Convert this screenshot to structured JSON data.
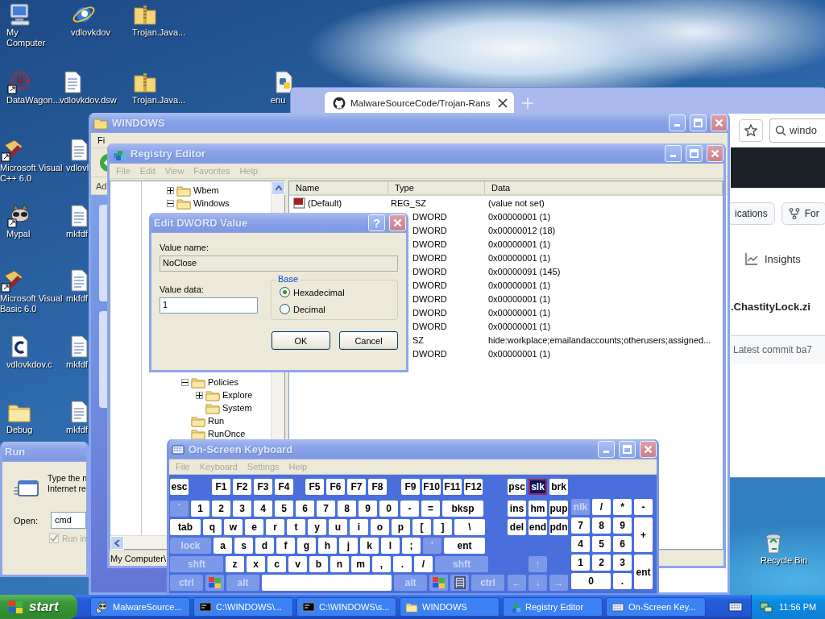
{
  "desktop_icons": [
    {
      "label": "My Computer",
      "kind": "computer"
    },
    {
      "label": "vdlovkdov",
      "kind": "globe"
    },
    {
      "label": "Trojan.Java...",
      "kind": "zip"
    },
    {
      "label": "DataWagon...",
      "kind": "wheel"
    },
    {
      "label": "vdlovkdov.dsw",
      "kind": "doc"
    },
    {
      "label": "Trojan.Java...",
      "kind": "zip"
    },
    {
      "label": "enu",
      "kind": "script"
    },
    {
      "label": "Microsoft Visual C++ 6.0",
      "kind": "tools"
    },
    {
      "label": "vdlovl",
      "kind": "doc"
    },
    {
      "label": "Mypal",
      "kind": "animal"
    },
    {
      "label": "mkfdf",
      "kind": "doc"
    },
    {
      "label": "Microsoft Visual Basic 6.0",
      "kind": "tools"
    },
    {
      "label": "mkfdf",
      "kind": "doc"
    },
    {
      "label": "vdlovkdov.c",
      "kind": "cfile"
    },
    {
      "label": "mkfdf",
      "kind": "doc"
    },
    {
      "label": "Debug",
      "kind": "folder"
    },
    {
      "label": "mkfdf",
      "kind": "doc"
    },
    {
      "label": "Recycle Bin",
      "kind": "bin"
    }
  ],
  "browser": {
    "tab_title": "MalwareSourceCode/Trojan-Rans",
    "search_value": "windo",
    "buttons": [
      {
        "label": "ications",
        "kind": "plain"
      },
      {
        "label": "For",
        "kind": "fork"
      }
    ],
    "insights": "Insights",
    "file_title": ".ChastityLock.zi",
    "commit": "Latest commit ba7"
  },
  "explorer": {
    "title": "WINDOWS",
    "menu_first": "Fi",
    "address_label": "Ad"
  },
  "run": {
    "title": "Run",
    "description": [
      "Type the n",
      "Internet re"
    ],
    "open_label": "Open:",
    "command": "cmd",
    "checkbox": {
      "label": "Run in",
      "checked": true,
      "disabled": true
    }
  },
  "regedit": {
    "title": "Registry Editor",
    "menu": [
      {
        "label": "File",
        "disabled": true
      },
      {
        "label": "Edit",
        "disabled": true
      },
      {
        "label": "View",
        "disabled": true
      },
      {
        "label": "Favorites",
        "disabled": true
      },
      {
        "label": "Help",
        "disabled": true
      }
    ],
    "tree": [
      {
        "label": "Wbem",
        "expanded": false
      },
      {
        "label": "Windows",
        "expanded": true,
        "children": [
          {
            "label": "Policies",
            "expanded": true,
            "children": [
              {
                "label": "Explore",
                "expanded": false
              },
              {
                "label": "System"
              }
            ]
          },
          {
            "label": "Run"
          },
          {
            "label": "RunOnce"
          }
        ]
      }
    ],
    "columns": [
      "Name",
      "Type",
      "Data"
    ],
    "rows": [
      {
        "name": "(Default)",
        "type": "REG_SZ",
        "data": "(value not set)"
      },
      {
        "type": "DWORD",
        "data": "0x00000001 (1)"
      },
      {
        "type": "DWORD",
        "data": "0x00000012 (18)"
      },
      {
        "type": "DWORD",
        "data": "0x00000001 (1)"
      },
      {
        "type": "DWORD",
        "data": "0x00000001 (1)"
      },
      {
        "type": "DWORD",
        "data": "0x00000091 (145)"
      },
      {
        "type": "DWORD",
        "data": "0x00000001 (1)"
      },
      {
        "type": "DWORD",
        "data": "0x00000001 (1)"
      },
      {
        "type": "DWORD",
        "data": "0x00000001 (1)"
      },
      {
        "type": "DWORD",
        "data": "0x00000001 (1)"
      },
      {
        "type": "SZ",
        "data": "hide:workplace;emailandaccounts;otherusers;assigned..."
      },
      {
        "type": "DWORD",
        "data": "0x00000001 (1)"
      }
    ],
    "status": "My Computer\\"
  },
  "dialog": {
    "title": "Edit DWORD Value",
    "help_button": "?",
    "value_name_label": "Value name:",
    "value_name": "NoClose",
    "value_data_label": "Value data:",
    "value_data": "1",
    "base_label": "Base",
    "bases": [
      {
        "label": "Hexadecimal",
        "selected": true
      },
      {
        "label": "Decimal",
        "selected": false
      }
    ],
    "buttons": [
      "OK",
      "Cancel"
    ]
  },
  "osk": {
    "title": "On-Screen Keyboard",
    "menu": [
      {
        "label": "File",
        "disabled": true
      },
      {
        "label": "Keyboard",
        "disabled": true
      },
      {
        "label": "Settings",
        "disabled": true
      },
      {
        "label": "Help",
        "disabled": true
      }
    ],
    "function_row": [
      {
        "label": "esc",
        "muted": false,
        "on": false
      },
      {
        "label": "F1",
        "muted": false,
        "on": false
      },
      {
        "label": "F2",
        "muted": false,
        "on": false
      },
      {
        "label": "F3",
        "muted": false,
        "on": false
      },
      {
        "label": "F4",
        "muted": false,
        "on": false
      },
      {
        "label": "F5",
        "muted": false,
        "on": false
      },
      {
        "label": "F6",
        "muted": false,
        "on": false
      },
      {
        "label": "F7",
        "muted": false,
        "on": false
      },
      {
        "label": "F8",
        "muted": false,
        "on": false
      },
      {
        "label": "F9",
        "muted": false,
        "on": false
      },
      {
        "label": "F10",
        "muted": false,
        "on": false
      },
      {
        "label": "F11",
        "muted": false,
        "on": false
      },
      {
        "label": "F12",
        "muted": false,
        "on": false
      }
    ],
    "main_rows": [
      [
        {
          "label": "`",
          "kind": "char",
          "muted": true,
          "on": false
        },
        {
          "label": "1",
          "kind": "char",
          "muted": false,
          "on": false
        },
        {
          "label": "2",
          "kind": "char",
          "muted": false,
          "on": false
        },
        {
          "label": "3",
          "kind": "char",
          "muted": false,
          "on": false
        },
        {
          "label": "4",
          "kind": "char",
          "muted": false,
          "on": false
        },
        {
          "label": "5",
          "kind": "char",
          "muted": false,
          "on": false
        },
        {
          "label": "6",
          "kind": "char",
          "muted": false,
          "on": false
        },
        {
          "label": "7",
          "kind": "char",
          "muted": false,
          "on": false
        },
        {
          "label": "8",
          "kind": "char",
          "muted": false,
          "on": false
        },
        {
          "label": "9",
          "kind": "char",
          "muted": false,
          "on": false
        },
        {
          "label": "0",
          "kind": "char",
          "muted": false,
          "on": false
        },
        {
          "label": "-",
          "kind": "char",
          "muted": false,
          "on": false
        },
        {
          "label": "=",
          "kind": "char",
          "muted": false,
          "on": false
        },
        {
          "label": "bksp",
          "kind": "double",
          "muted": false,
          "on": false
        }
      ],
      [
        {
          "label": "tab",
          "kind": "wide",
          "muted": false,
          "on": false
        },
        {
          "label": "q",
          "kind": "char",
          "muted": false,
          "on": false
        },
        {
          "label": "w",
          "kind": "char",
          "muted": false,
          "on": false
        },
        {
          "label": "e",
          "kind": "char",
          "muted": false,
          "on": false
        },
        {
          "label": "r",
          "kind": "char",
          "muted": false,
          "on": false
        },
        {
          "label": "t",
          "kind": "char",
          "muted": false,
          "on": false
        },
        {
          "label": "y",
          "kind": "char",
          "muted": false,
          "on": false
        },
        {
          "label": "u",
          "kind": "char",
          "muted": false,
          "on": false
        },
        {
          "label": "i",
          "kind": "char",
          "muted": false,
          "on": false
        },
        {
          "label": "o",
          "kind": "char",
          "muted": false,
          "on": false
        },
        {
          "label": "p",
          "kind": "char",
          "muted": false,
          "on": false
        },
        {
          "label": "[",
          "kind": "char",
          "muted": false,
          "on": false
        },
        {
          "label": "]",
          "kind": "char",
          "muted": false,
          "on": false
        },
        {
          "label": "\\",
          "kind": "wide",
          "muted": false,
          "on": false
        }
      ],
      [
        {
          "label": "lock",
          "kind": "double",
          "muted": true,
          "on": false
        },
        {
          "label": "a",
          "kind": "char",
          "muted": false,
          "on": false
        },
        {
          "label": "s",
          "kind": "char",
          "muted": false,
          "on": false
        },
        {
          "label": "d",
          "kind": "char",
          "muted": false,
          "on": false
        },
        {
          "label": "f",
          "kind": "char",
          "muted": false,
          "on": false
        },
        {
          "label": "g",
          "kind": "char",
          "muted": false,
          "on": false
        },
        {
          "label": "h",
          "kind": "char",
          "muted": false,
          "on": false
        },
        {
          "label": "j",
          "kind": "char",
          "muted": false,
          "on": false
        },
        {
          "label": "k",
          "kind": "char",
          "muted": false,
          "on": false
        },
        {
          "label": "l",
          "kind": "char",
          "muted": false,
          "on": false
        },
        {
          "label": ";",
          "kind": "char",
          "muted": false,
          "on": false
        },
        {
          "label": "'",
          "kind": "char",
          "muted": true,
          "on": false
        },
        {
          "label": "ent",
          "kind": "double",
          "muted": false,
          "on": false
        }
      ],
      [
        {
          "label": "shft",
          "kind": "shift",
          "muted": true,
          "on": false
        },
        {
          "label": "z",
          "kind": "char",
          "muted": false,
          "on": false
        },
        {
          "label": "x",
          "kind": "char",
          "muted": false,
          "on": false
        },
        {
          "label": "c",
          "kind": "char",
          "muted": false,
          "on": false
        },
        {
          "label": "v",
          "kind": "char",
          "muted": false,
          "on": false
        },
        {
          "label": "b",
          "kind": "char",
          "muted": false,
          "on": false
        },
        {
          "label": "n",
          "kind": "char",
          "muted": false,
          "on": false
        },
        {
          "label": "m",
          "kind": "char",
          "muted": false,
          "on": false
        },
        {
          "label": ",",
          "kind": "char",
          "muted": false,
          "on": false
        },
        {
          "label": ".",
          "kind": "char",
          "muted": false,
          "on": false
        },
        {
          "label": "/",
          "kind": "char",
          "muted": false,
          "on": false
        },
        {
          "label": "shft",
          "kind": "shift",
          "muted": true,
          "on": false
        }
      ],
      [
        {
          "label": "ctrl",
          "kind": "mod",
          "muted": true,
          "on": false
        },
        {
          "kind": "win",
          "muted": true,
          "on": false
        },
        {
          "label": "alt",
          "kind": "mod",
          "muted": true,
          "on": false
        },
        {
          "kind": "space",
          "muted": false,
          "on": false
        },
        {
          "label": "alt",
          "kind": "mod",
          "muted": true,
          "on": false
        },
        {
          "kind": "win",
          "muted": true,
          "on": false
        },
        {
          "kind": "menu",
          "muted": true,
          "on": false
        },
        {
          "label": "ctrl",
          "kind": "mod",
          "muted": true,
          "on": false
        }
      ]
    ],
    "nav_rows": [
      [
        {
          "label": "psc",
          "muted": false,
          "on": false
        },
        {
          "label": "slk",
          "muted": false,
          "on": true
        },
        {
          "label": "brk",
          "muted": false,
          "on": false
        }
      ],
      [
        {
          "label": "ins",
          "muted": false,
          "on": false
        },
        {
          "label": "hm",
          "muted": false,
          "on": false
        },
        {
          "label": "pup",
          "muted": false,
          "on": false
        }
      ],
      [
        {
          "label": "del",
          "muted": false,
          "on": false
        },
        {
          "label": "end",
          "muted": false,
          "on": false
        },
        {
          "label": "pdn",
          "muted": false,
          "on": false
        }
      ]
    ],
    "arrows": [
      {
        "label": "↑",
        "muted": true,
        "on": false
      },
      {
        "label": "←",
        "muted": true,
        "on": false
      },
      {
        "label": "↓",
        "muted": true,
        "on": false
      },
      {
        "label": "→",
        "muted": true,
        "on": false
      }
    ],
    "numpad": [
      {
        "label": "nlk",
        "kind": "nav",
        "muted": true,
        "on": false
      },
      {
        "label": "/",
        "kind": "nav",
        "muted": false,
        "on": false
      },
      {
        "label": "*",
        "kind": "nav",
        "muted": false,
        "on": false
      },
      {
        "label": "-",
        "kind": "nav",
        "muted": false,
        "on": false
      },
      {
        "label": "7",
        "kind": "nav",
        "muted": false,
        "on": false
      },
      {
        "label": "8",
        "kind": "nav",
        "muted": false,
        "on": false
      },
      {
        "label": "9",
        "kind": "nav",
        "muted": false,
        "on": false
      },
      {
        "label": "+",
        "kind": "tall",
        "muted": false,
        "on": false
      },
      {
        "label": "4",
        "kind": "nav",
        "muted": false,
        "on": false
      },
      {
        "label": "5",
        "kind": "nav",
        "muted": false,
        "on": false
      },
      {
        "label": "6",
        "kind": "nav",
        "muted": false,
        "on": false
      },
      {
        "label": "1",
        "kind": "nav",
        "muted": false,
        "on": false
      },
      {
        "label": "2",
        "kind": "nav",
        "muted": false,
        "on": false
      },
      {
        "label": "3",
        "kind": "nav",
        "muted": false,
        "on": false
      },
      {
        "label": "ent",
        "kind": "tall",
        "muted": false,
        "on": false
      },
      {
        "label": "0",
        "kind": "broad",
        "muted": false,
        "on": false
      },
      {
        "label": ".",
        "kind": "nav",
        "muted": false,
        "on": false
      }
    ]
  },
  "taskbar": {
    "start": "start",
    "items": [
      {
        "label": "MalwareSource...",
        "kind": "animal",
        "selected": false
      },
      {
        "label": "C:\\WINDOWS\\...",
        "kind": "console",
        "selected": false
      },
      {
        "label": "C:\\WINDOWS\\s...",
        "kind": "console",
        "selected": false
      },
      {
        "label": "WINDOWS",
        "kind": "folder",
        "selected": false
      },
      {
        "label": "Registry Editor",
        "kind": "registry",
        "selected": false
      },
      {
        "label": "On-Screen Key...",
        "kind": "keyboard",
        "selected": false
      }
    ],
    "clock": "11:56 PM"
  }
}
